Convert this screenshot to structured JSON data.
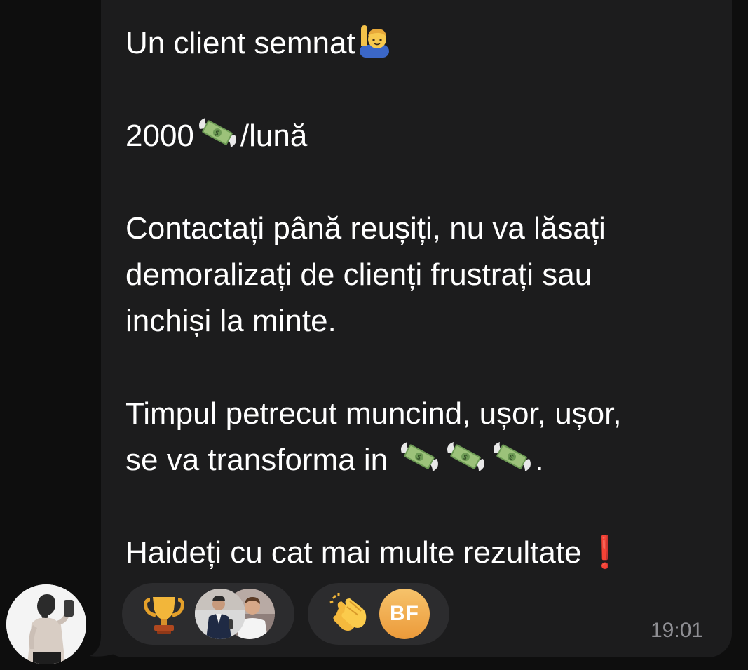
{
  "message": {
    "line1": "Un client semnat",
    "line2_amount": "2000",
    "line2_suffix": "/lună",
    "para3_line1": "Contactați până reușiți, nu va lăsați",
    "para3_line2": "demoralizați de clienți frustrați sau",
    "para3_line3": "inchiși la minte.",
    "para4_line1": "Timpul petrecut muncind, ușor, ușor,",
    "para4_line2": "se va transforma in",
    "para4_end": ".",
    "para5": "Haideți cu cat mai multe rezultate",
    "para5_mark": "❗",
    "timestamp": "19:01"
  },
  "emojis": {
    "raising_hand": "person-raising-hand-icon",
    "money_wings": "money-with-wings-icon"
  },
  "reactions": [
    {
      "icon": "trophy-icon",
      "users": [
        "user-photo-1",
        "user-photo-2"
      ]
    },
    {
      "icon": "clapping-hands-icon",
      "users_initials": "BF"
    }
  ],
  "colors": {
    "background": "#0e0e0e",
    "bubble": "#1c1c1d",
    "reaction_pill": "#2c2c2e",
    "text": "#ffffff",
    "timestamp": "#8e8e93",
    "initials_avatar": "#ec9a3a",
    "exclamation": "#e23b3b"
  }
}
